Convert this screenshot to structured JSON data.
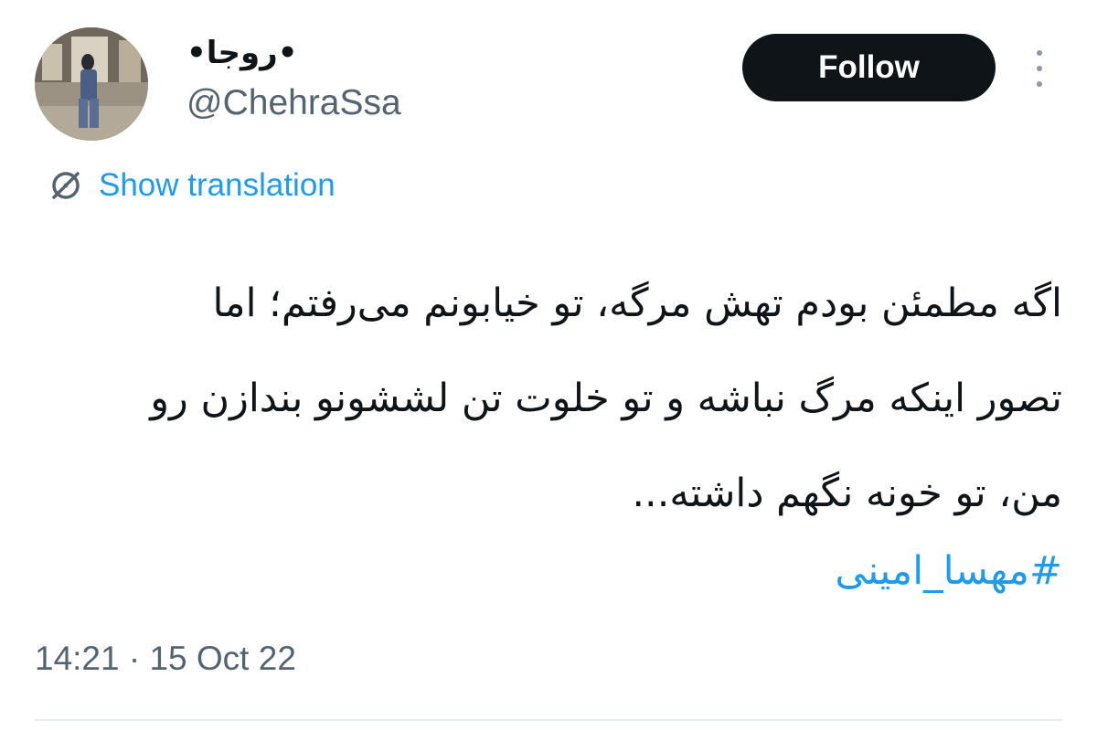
{
  "author": {
    "display_name": "•روجا•",
    "handle": "@ChehraSsa"
  },
  "actions": {
    "follow_label": "Follow",
    "more_icon": "more-vertical-icon"
  },
  "translation": {
    "icon": "globe-translate-icon",
    "label": "Show translation"
  },
  "tweet": {
    "lines": [
      "اگه مطمئن بودم تهش مرگه، تو خیابونم می‌رفتم؛ اما",
      "تصور اینکه مرگ نباشه و تو خلوت تن لششونو بندازن رو",
      "من، تو خونه نگهم داشته..."
    ],
    "hashtag": "#مهسا_امینی",
    "timestamp": "14:21 · 15 Oct 22"
  },
  "colors": {
    "accent": "#1d9bf0",
    "text": "#0f1419",
    "muted": "#536471",
    "button_bg": "#0f1419",
    "button_text": "#ffffff"
  }
}
